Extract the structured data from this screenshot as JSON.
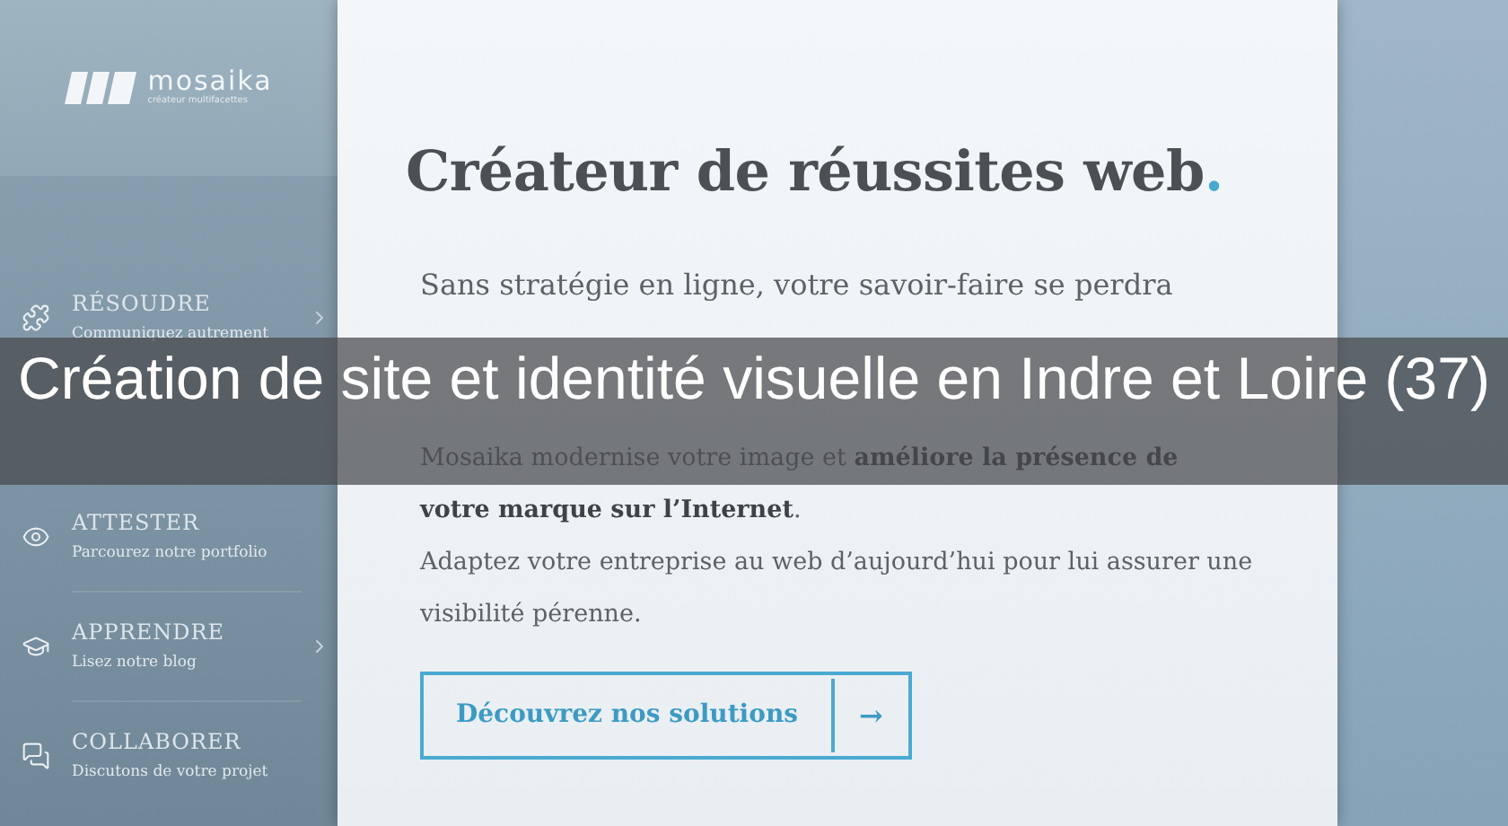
{
  "logo": {
    "name": "mosaika",
    "tagline": "créateur multifacettes"
  },
  "nav": [
    {
      "kind": "puzzle",
      "title": "RÉSOUDRE",
      "subtitle": "Communiquez autrement",
      "has_submenu": true
    },
    {
      "kind": "eye",
      "title": "ATTESTER",
      "subtitle": "Parcourez notre portfolio",
      "has_submenu": false
    },
    {
      "kind": "cap",
      "title": "APPRENDRE",
      "subtitle": "Lisez notre blog",
      "has_submenu": true
    },
    {
      "kind": "chat",
      "title": "COLLABORER",
      "subtitle": "Discutons de votre projet",
      "has_submenu": false
    }
  ],
  "main": {
    "heading": "Créateur de réussites web",
    "heading_accent": ".",
    "intro": "Sans stratégie en ligne, votre savoir-faire se perdra",
    "body": [
      "Mosaika modernise votre image et **améliore la présence de votre marque sur l’Internet**.",
      "Adaptez votre entreprise au web d’aujourd’hui pour lui assurer une visibilité pérenne."
    ],
    "cta": {
      "label": "Découvrez nos solutions",
      "arrow": "→"
    }
  },
  "caption": "Création de site et identité visuelle en Indre et Loire (37)"
}
